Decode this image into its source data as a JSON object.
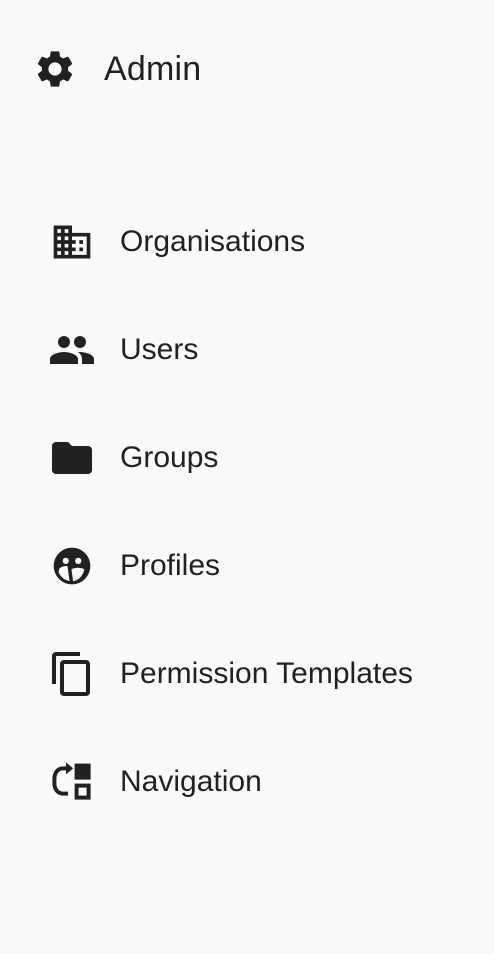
{
  "header": {
    "icon": "gear-icon",
    "title": "Admin"
  },
  "nav": {
    "items": [
      {
        "label": "Organisations",
        "icon": "building-icon"
      },
      {
        "label": "Users",
        "icon": "people-icon"
      },
      {
        "label": "Groups",
        "icon": "folder-icon"
      },
      {
        "label": "Profiles",
        "icon": "face-profile-icon"
      },
      {
        "label": "Permission Templates",
        "icon": "copy-icon"
      },
      {
        "label": "Navigation",
        "icon": "redo-layout-icon"
      }
    ]
  },
  "colors": {
    "background": "#fafafa",
    "text": "#212121",
    "icon": "#212121"
  }
}
